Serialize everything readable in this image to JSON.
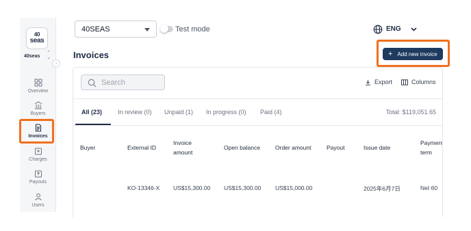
{
  "org_selector": {
    "value": "40SEAS"
  },
  "test_mode": {
    "label": "Test mode",
    "enabled": false
  },
  "language": {
    "label": "ENG"
  },
  "sidebar": {
    "logo_top": "40",
    "logo_bottom": "seas",
    "org_name": "40seas",
    "items": [
      {
        "label": "Overview",
        "icon": "grid-icon"
      },
      {
        "label": "Buyers",
        "icon": "building-icon"
      },
      {
        "label": "Invoices",
        "icon": "invoice-icon",
        "active": true
      },
      {
        "label": "Charges",
        "icon": "charges-icon"
      },
      {
        "label": "Payouts",
        "icon": "payout-icon"
      },
      {
        "label": "Users",
        "icon": "user-icon"
      }
    ]
  },
  "page": {
    "title": "Invoices",
    "add_button": "Add new invoice"
  },
  "toolbar": {
    "search_placeholder": "Search",
    "export_label": "Export",
    "columns_label": "Columns"
  },
  "tabs": [
    {
      "label": "All (23)",
      "active": true
    },
    {
      "label": "In review (0)"
    },
    {
      "label": "Unpaid (1)"
    },
    {
      "label": "In progress (0)"
    },
    {
      "label": "Paid (4)"
    }
  ],
  "total": "Total: $119,051.65",
  "table": {
    "headers": {
      "buyer": "Buyer",
      "external_id": "External ID",
      "invoice_amount_1": "Invoice",
      "invoice_amount_2": "amount",
      "open_balance": "Open balance",
      "order_amount": "Order amount",
      "payout": "Payout",
      "issue_date": "Issue date",
      "payment_term_1": "Payment",
      "payment_term_2": "term"
    },
    "rows": [
      {
        "buyer": "",
        "external_id": "KO-13346-X",
        "invoice_amount": "US$15,300.00",
        "open_balance": "US$15,300.00",
        "order_amount": "US$15,000.00",
        "payout": "",
        "issue_date": "2025年6月7日",
        "payment_term": "Net 60"
      }
    ]
  },
  "colors": {
    "accent": "#1e3a5f",
    "highlight": "#f0701e",
    "sidebar_bg": "#f5f6f7"
  }
}
